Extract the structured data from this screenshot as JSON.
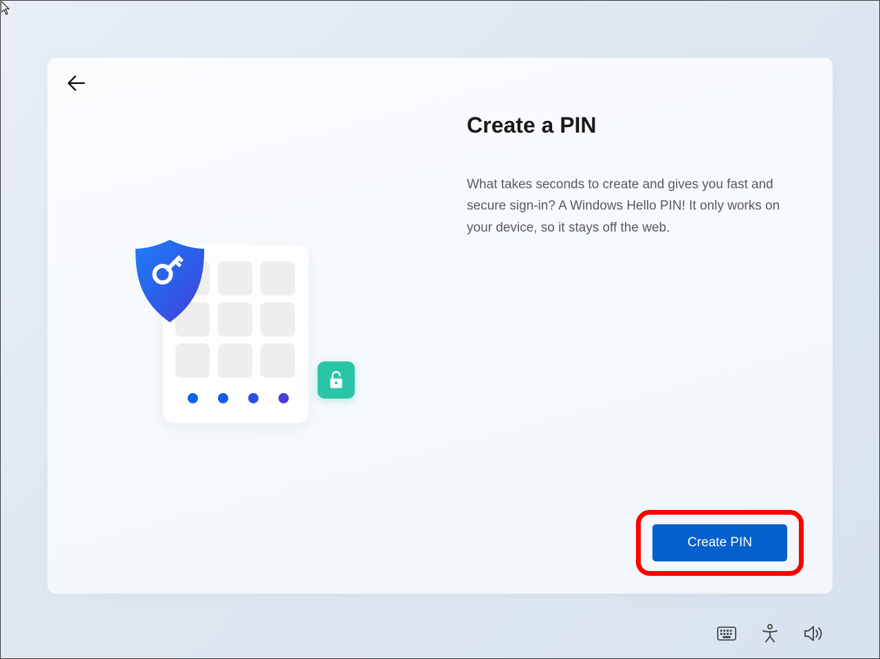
{
  "dialog": {
    "title": "Create a PIN",
    "description": "What takes seconds to create and gives you fast and secure sign-in? A Windows Hello PIN! It only works on your device, so it stays off the web.",
    "primary_button_label": "Create PIN"
  },
  "icons": {
    "back": "back-arrow",
    "shield": "shield-key",
    "unlock": "unlock-padlock",
    "keyboard": "on-screen-keyboard",
    "accessibility": "accessibility",
    "volume": "volume-speaker"
  },
  "colors": {
    "primary": "#0560cc",
    "highlight": "#ff0000",
    "accent_teal": "#29c5a8"
  }
}
